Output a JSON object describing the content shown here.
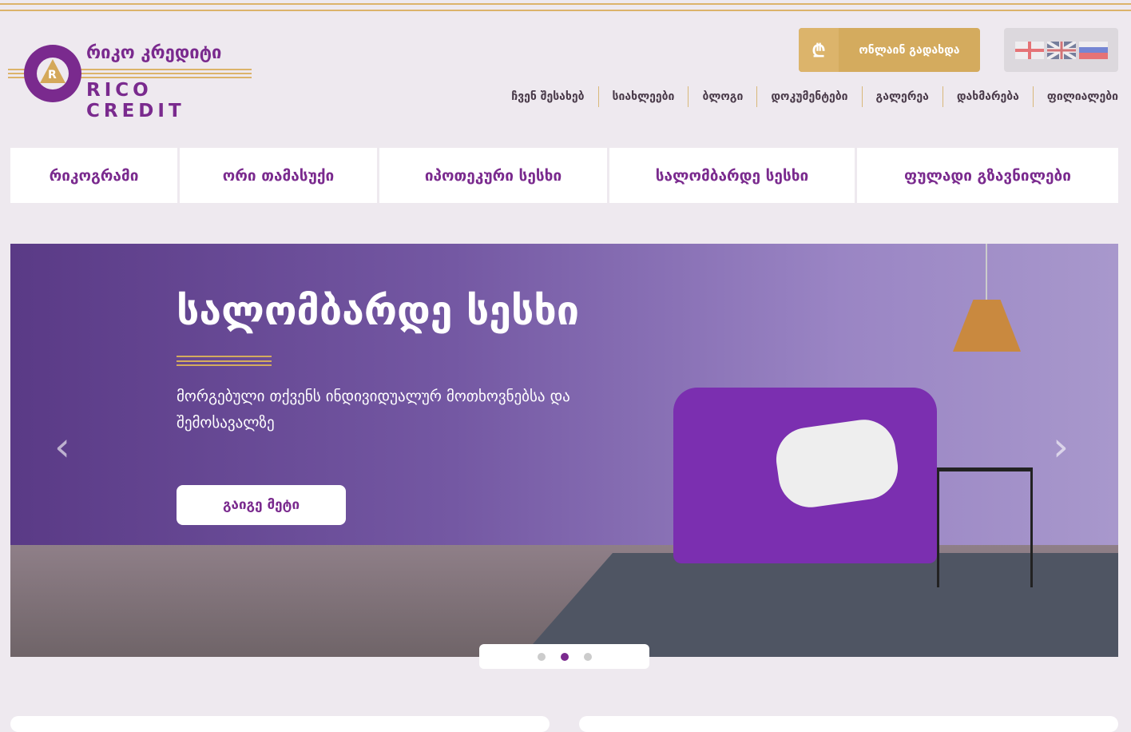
{
  "logo": {
    "name_ka": "რიკო კრედიტი",
    "name_en": "RICO CREDIT",
    "mark": "R"
  },
  "header": {
    "pay_label": "ონლაინ გადახდა",
    "pay_icon": "₾",
    "languages": [
      "ka",
      "en",
      "ru"
    ]
  },
  "nav": [
    "ჩვენ შესახებ",
    "სიახლეები",
    "ბლოგი",
    "დოკუმენტები",
    "გალერეა",
    "დახმარება",
    "ფილიალები"
  ],
  "tabs": [
    "რიკოგრამი",
    "ორი თამასუქი",
    "იპოთეკური სესხი",
    "სალომბარდე სესხი",
    "ფულადი გზავნილები"
  ],
  "hero": {
    "title": "სალომბარდე სესხი",
    "subtitle": "მორგებული თქვენს ინდივიდუალურ მოთხოვნებსა და შემოსავალზე",
    "button": "გაიგე მეტი",
    "prev": "‹",
    "next": "›",
    "active_slide": 2,
    "slide_count": 3
  },
  "colors": {
    "brand": "#7a2a8e",
    "gold": "#d4ab5e",
    "background": "#eee9ef"
  }
}
